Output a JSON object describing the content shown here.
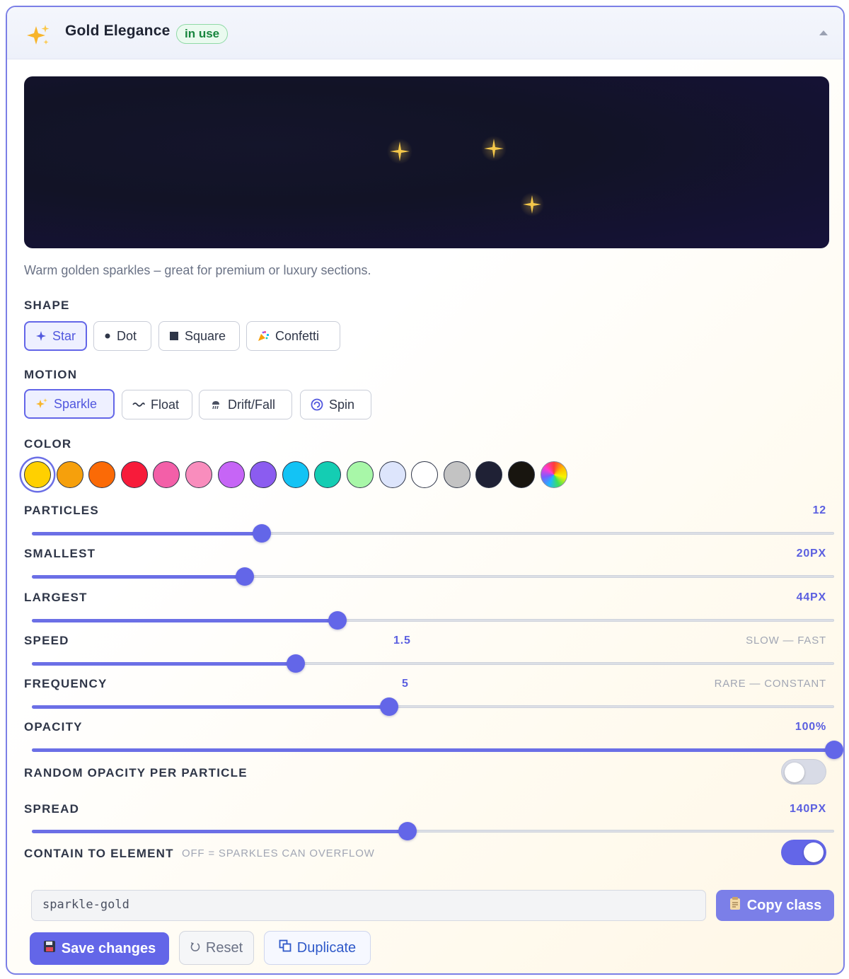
{
  "header": {
    "icon": "sparkles-icon",
    "title": "Gold Elegance",
    "badge": "in use",
    "collapse_icon": "chevron-up-icon"
  },
  "preview": {
    "sparkle_color": "#f5c84a",
    "background": "#141330"
  },
  "description": "Warm golden sparkles – great for premium or luxury sections.",
  "shape": {
    "label": "SHAPE",
    "options": [
      {
        "label": "Star",
        "icon": "star-icon",
        "active": true
      },
      {
        "label": "Dot",
        "icon": "dot-icon",
        "active": false
      },
      {
        "label": "Square",
        "icon": "square-icon",
        "active": false
      },
      {
        "label": "Confetti",
        "icon": "confetti-icon",
        "active": false
      }
    ]
  },
  "motion": {
    "label": "MOTION",
    "options": [
      {
        "label": "Sparkle",
        "icon": "sparkles-icon",
        "active": true
      },
      {
        "label": "Float",
        "icon": "float-icon",
        "active": false
      },
      {
        "label": "Drift/Fall",
        "icon": "drift-icon",
        "active": false
      },
      {
        "label": "Spin",
        "icon": "spin-icon",
        "active": false
      }
    ]
  },
  "color": {
    "label": "COLOR",
    "selected": 0,
    "swatches": [
      "#ffd000",
      "#f6a00c",
      "#fb6a06",
      "#f71b3a",
      "#f35fa8",
      "#f98dbd",
      "#c665f6",
      "#8b5cf0",
      "#13c3f5",
      "#14cdb3",
      "#a8f7a8",
      "#dde5fc",
      "#ffffff",
      "#c3c3c3",
      "#1f2135",
      "#18150f",
      "rainbow"
    ]
  },
  "sliders": {
    "particles": {
      "label": "PARTICLES",
      "value": "12",
      "fraction": 0.287
    },
    "smallest": {
      "label": "SMALLEST",
      "value": "20PX",
      "fraction": 0.265
    },
    "largest": {
      "label": "LARGEST",
      "value": "44PX",
      "fraction": 0.381
    },
    "speed": {
      "label": "SPEED",
      "value": "1.5",
      "hint": "SLOW — FAST",
      "fraction": 0.329
    },
    "frequency": {
      "label": "FREQUENCY",
      "value": "5",
      "hint": "RARE — CONSTANT",
      "fraction": 0.445
    },
    "opacity": {
      "label": "OPACITY",
      "value": "100%",
      "fraction": 1.0
    },
    "spread": {
      "label": "SPREAD",
      "value": "140PX",
      "fraction": 0.468
    }
  },
  "random_opacity": {
    "label": "RANDOM OPACITY PER PARTICLE",
    "on": false
  },
  "contain": {
    "label": "CONTAIN TO ELEMENT",
    "hint": "OFF = SPARKLES CAN OVERFLOW",
    "on": true
  },
  "class_name": "sparkle-gold",
  "buttons": {
    "copy": "Copy class",
    "save": "Save changes",
    "reset": "Reset",
    "duplicate": "Duplicate"
  }
}
